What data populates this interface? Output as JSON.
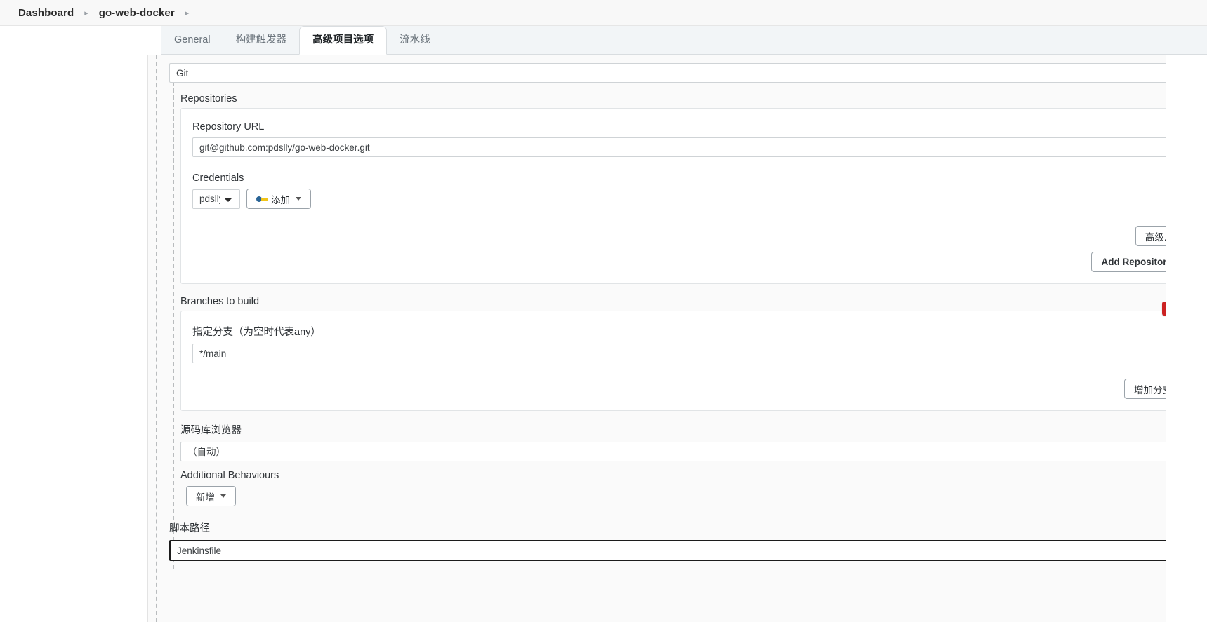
{
  "breadcrumb": {
    "items": [
      {
        "label": "Dashboard"
      },
      {
        "label": "go-web-docker"
      }
    ],
    "separator": "▸"
  },
  "tabs": [
    {
      "label": "General",
      "active": false
    },
    {
      "label": "构建触发器",
      "active": false
    },
    {
      "label": "高级项目选项",
      "active": true
    },
    {
      "label": "流水线",
      "active": false
    }
  ],
  "scm": {
    "selected": "Git",
    "options": [
      "Git"
    ]
  },
  "repositories": {
    "title": "Repositories",
    "help": "?",
    "repository_url": {
      "label": "Repository URL",
      "value": "git@github.com:pdslly/go-web-docker.git",
      "help": "?"
    },
    "credentials": {
      "label": "Credentials",
      "selected": "pdslly",
      "options": [
        "pdslly"
      ],
      "add_button": "添加",
      "add_icon": "key-icon",
      "help": "?"
    },
    "advanced_button": "高级...",
    "add_repository_button": "Add Repository"
  },
  "branches": {
    "title": "Branches to build",
    "help": "?",
    "delete_label": "X",
    "specifier": {
      "label": "指定分支（为空时代表any）",
      "value": "*/main",
      "help": "?"
    },
    "add_branch_button": "增加分支"
  },
  "repository_browser": {
    "label": "源码库浏览器",
    "selected": "（自动）",
    "options": [
      "（自动）"
    ],
    "help": "?"
  },
  "additional_behaviours": {
    "label": "Additional Behaviours",
    "add_button": "新增"
  },
  "script_path": {
    "label": "脚本路径",
    "value": "Jenkinsfile",
    "help": "?"
  },
  "colors": {
    "help_blue": "#1a6aa2",
    "delete_red": "#cc2222",
    "accent_key_blue": "#2a6496",
    "accent_key_yellow": "#f0c419"
  }
}
